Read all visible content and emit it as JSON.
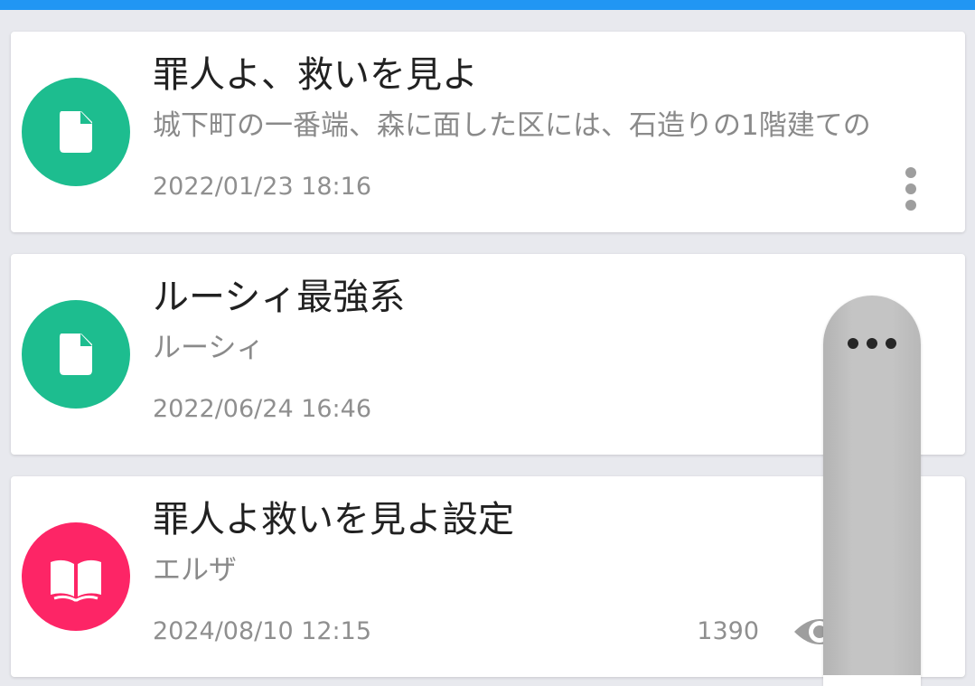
{
  "colors": {
    "top_bar": "#2196f3",
    "document_avatar": "#1dbd8f",
    "book_avatar": "#fd2566"
  },
  "cards": [
    {
      "icon": "document-icon",
      "title": "罪人よ、救いを見よ",
      "subtitle": "城下町の一番端、森に面した区には、石造りの1階建ての",
      "date": "2022/01/23 18:16"
    },
    {
      "icon": "document-icon",
      "title": "ルーシィ最強系",
      "subtitle": "ルーシィ",
      "date": "2022/06/24 16:46"
    },
    {
      "icon": "book-icon",
      "title": "罪人よ救いを見よ設定",
      "subtitle": "エルザ",
      "date": "2024/08/10 12:15",
      "views": "1390",
      "views_icon": "eye-icon"
    }
  ],
  "card_menu_icon": "more-vert-icon",
  "scroll_handle_icon": "more-horiz-icon"
}
